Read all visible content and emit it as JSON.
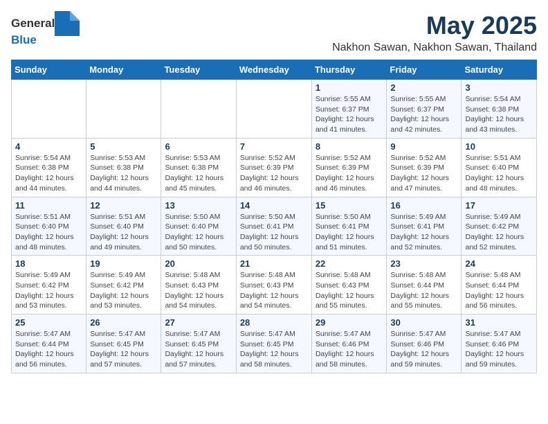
{
  "header": {
    "logo_general": "General",
    "logo_blue": "Blue",
    "title": "May 2025",
    "subtitle": "Nakhon Sawan, Nakhon Sawan, Thailand"
  },
  "weekdays": [
    "Sunday",
    "Monday",
    "Tuesday",
    "Wednesday",
    "Thursday",
    "Friday",
    "Saturday"
  ],
  "weeks": [
    [
      {
        "day": "",
        "info": ""
      },
      {
        "day": "",
        "info": ""
      },
      {
        "day": "",
        "info": ""
      },
      {
        "day": "",
        "info": ""
      },
      {
        "day": "1",
        "info": "Sunrise: 5:55 AM\nSunset: 6:37 PM\nDaylight: 12 hours\nand 41 minutes."
      },
      {
        "day": "2",
        "info": "Sunrise: 5:55 AM\nSunset: 6:37 PM\nDaylight: 12 hours\nand 42 minutes."
      },
      {
        "day": "3",
        "info": "Sunrise: 5:54 AM\nSunset: 6:38 PM\nDaylight: 12 hours\nand 43 minutes."
      }
    ],
    [
      {
        "day": "4",
        "info": "Sunrise: 5:54 AM\nSunset: 6:38 PM\nDaylight: 12 hours\nand 44 minutes."
      },
      {
        "day": "5",
        "info": "Sunrise: 5:53 AM\nSunset: 6:38 PM\nDaylight: 12 hours\nand 44 minutes."
      },
      {
        "day": "6",
        "info": "Sunrise: 5:53 AM\nSunset: 6:38 PM\nDaylight: 12 hours\nand 45 minutes."
      },
      {
        "day": "7",
        "info": "Sunrise: 5:52 AM\nSunset: 6:39 PM\nDaylight: 12 hours\nand 46 minutes."
      },
      {
        "day": "8",
        "info": "Sunrise: 5:52 AM\nSunset: 6:39 PM\nDaylight: 12 hours\nand 46 minutes."
      },
      {
        "day": "9",
        "info": "Sunrise: 5:52 AM\nSunset: 6:39 PM\nDaylight: 12 hours\nand 47 minutes."
      },
      {
        "day": "10",
        "info": "Sunrise: 5:51 AM\nSunset: 6:40 PM\nDaylight: 12 hours\nand 48 minutes."
      }
    ],
    [
      {
        "day": "11",
        "info": "Sunrise: 5:51 AM\nSunset: 6:40 PM\nDaylight: 12 hours\nand 48 minutes."
      },
      {
        "day": "12",
        "info": "Sunrise: 5:51 AM\nSunset: 6:40 PM\nDaylight: 12 hours\nand 49 minutes."
      },
      {
        "day": "13",
        "info": "Sunrise: 5:50 AM\nSunset: 6:40 PM\nDaylight: 12 hours\nand 50 minutes."
      },
      {
        "day": "14",
        "info": "Sunrise: 5:50 AM\nSunset: 6:41 PM\nDaylight: 12 hours\nand 50 minutes."
      },
      {
        "day": "15",
        "info": "Sunrise: 5:50 AM\nSunset: 6:41 PM\nDaylight: 12 hours\nand 51 minutes."
      },
      {
        "day": "16",
        "info": "Sunrise: 5:49 AM\nSunset: 6:41 PM\nDaylight: 12 hours\nand 52 minutes."
      },
      {
        "day": "17",
        "info": "Sunrise: 5:49 AM\nSunset: 6:42 PM\nDaylight: 12 hours\nand 52 minutes."
      }
    ],
    [
      {
        "day": "18",
        "info": "Sunrise: 5:49 AM\nSunset: 6:42 PM\nDaylight: 12 hours\nand 53 minutes."
      },
      {
        "day": "19",
        "info": "Sunrise: 5:49 AM\nSunset: 6:42 PM\nDaylight: 12 hours\nand 53 minutes."
      },
      {
        "day": "20",
        "info": "Sunrise: 5:48 AM\nSunset: 6:43 PM\nDaylight: 12 hours\nand 54 minutes."
      },
      {
        "day": "21",
        "info": "Sunrise: 5:48 AM\nSunset: 6:43 PM\nDaylight: 12 hours\nand 54 minutes."
      },
      {
        "day": "22",
        "info": "Sunrise: 5:48 AM\nSunset: 6:43 PM\nDaylight: 12 hours\nand 55 minutes."
      },
      {
        "day": "23",
        "info": "Sunrise: 5:48 AM\nSunset: 6:44 PM\nDaylight: 12 hours\nand 55 minutes."
      },
      {
        "day": "24",
        "info": "Sunrise: 5:48 AM\nSunset: 6:44 PM\nDaylight: 12 hours\nand 56 minutes."
      }
    ],
    [
      {
        "day": "25",
        "info": "Sunrise: 5:47 AM\nSunset: 6:44 PM\nDaylight: 12 hours\nand 56 minutes."
      },
      {
        "day": "26",
        "info": "Sunrise: 5:47 AM\nSunset: 6:45 PM\nDaylight: 12 hours\nand 57 minutes."
      },
      {
        "day": "27",
        "info": "Sunrise: 5:47 AM\nSunset: 6:45 PM\nDaylight: 12 hours\nand 57 minutes."
      },
      {
        "day": "28",
        "info": "Sunrise: 5:47 AM\nSunset: 6:45 PM\nDaylight: 12 hours\nand 58 minutes."
      },
      {
        "day": "29",
        "info": "Sunrise: 5:47 AM\nSunset: 6:46 PM\nDaylight: 12 hours\nand 58 minutes."
      },
      {
        "day": "30",
        "info": "Sunrise: 5:47 AM\nSunset: 6:46 PM\nDaylight: 12 hours\nand 59 minutes."
      },
      {
        "day": "31",
        "info": "Sunrise: 5:47 AM\nSunset: 6:46 PM\nDaylight: 12 hours\nand 59 minutes."
      }
    ]
  ]
}
